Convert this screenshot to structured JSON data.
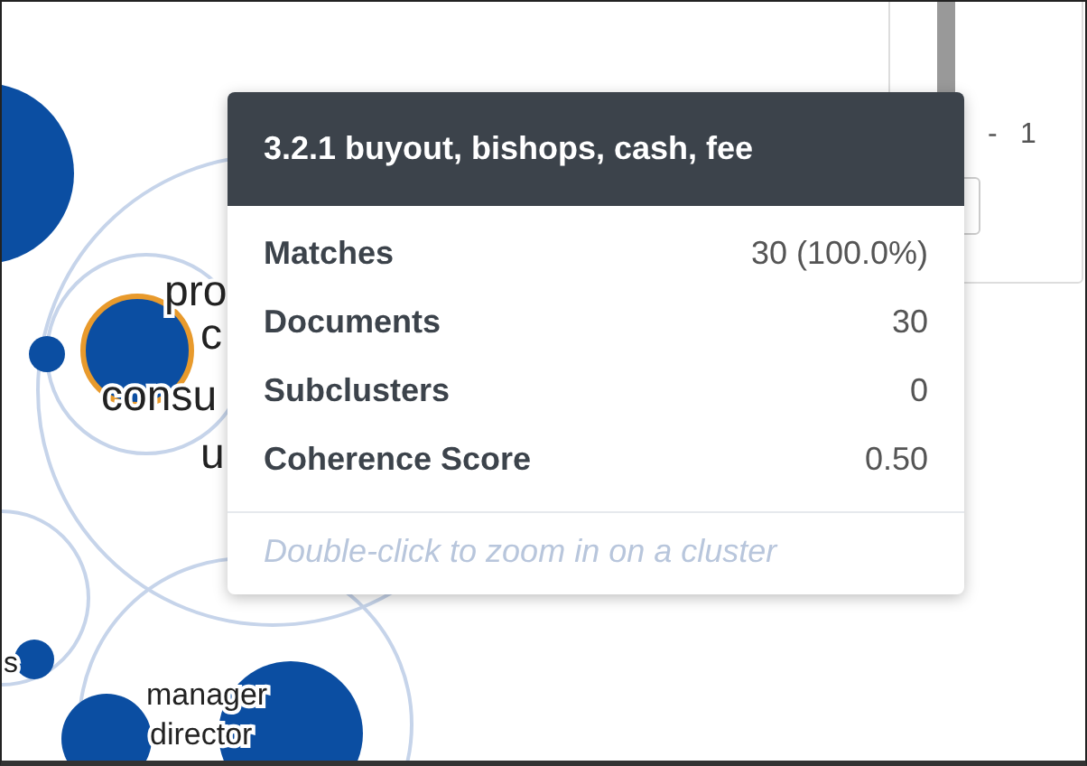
{
  "bubble_labels": [
    "pro",
    "c",
    "consu",
    "u",
    "s",
    "manager",
    "director"
  ],
  "side_panel": {
    "range_dash": "-",
    "range_value": "1"
  },
  "tooltip": {
    "title": "3.2.1 buyout, bishops, cash, fee",
    "rows": [
      {
        "label": "Matches",
        "value": "30 (100.0%)"
      },
      {
        "label": "Documents",
        "value": "30"
      },
      {
        "label": "Subclusters",
        "value": "0"
      },
      {
        "label": "Coherence Score",
        "value": "0.50"
      }
    ],
    "hint": "Double-click to zoom in on a cluster"
  }
}
